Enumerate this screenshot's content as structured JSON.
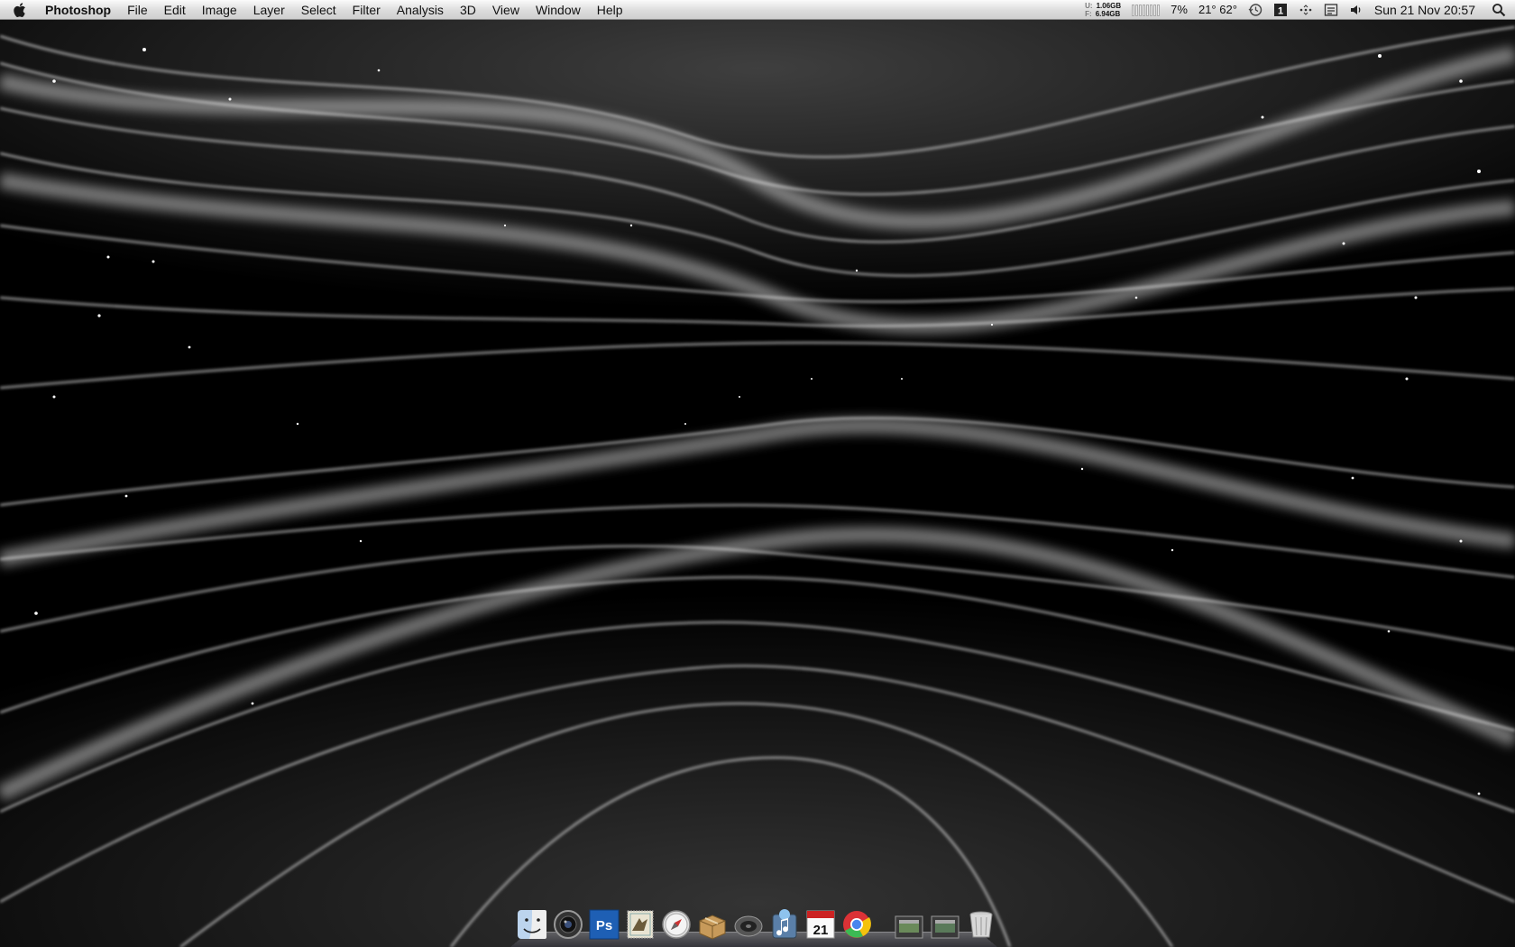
{
  "menubar": {
    "apple_icon": "apple-logo-icon",
    "app_name": "Photoshop",
    "menus": [
      "File",
      "Edit",
      "Image",
      "Layer",
      "Select",
      "Filter",
      "Analysis",
      "3D",
      "View",
      "Window",
      "Help"
    ],
    "status": {
      "memory_used_key": "U:",
      "memory_used": "1.06GB",
      "memory_free_key": "F:",
      "memory_free": "6.94GB",
      "cpu_percent": "7%",
      "temperature": "21° 62°",
      "datetime": "Sun 21 Nov  20:57"
    }
  },
  "dock": {
    "items": [
      {
        "name": "finder",
        "icon": "finder-icon"
      },
      {
        "name": "aperture",
        "icon": "aperture-lens-icon"
      },
      {
        "name": "photoshop",
        "icon": "photoshop-icon",
        "label": "Ps"
      },
      {
        "name": "mail",
        "icon": "mail-stamp-icon"
      },
      {
        "name": "safari",
        "icon": "safari-compass-icon"
      },
      {
        "name": "installer",
        "icon": "package-box-icon"
      },
      {
        "name": "speaker",
        "icon": "speaker-icon"
      },
      {
        "name": "itunes",
        "icon": "itunes-icon"
      },
      {
        "name": "ical",
        "icon": "calendar-icon",
        "label": "21"
      },
      {
        "name": "chrome",
        "icon": "chrome-icon"
      },
      {
        "name": "stack-1",
        "icon": "folder-stack-icon"
      },
      {
        "name": "stack-2",
        "icon": "folder-stack-icon"
      },
      {
        "name": "trash",
        "icon": "trash-icon"
      }
    ]
  },
  "colors": {
    "wallpaper_bg": "#000000",
    "wave": "#d8d8d8",
    "photoshop_blue": "#1e5fb4",
    "menubar_text": "#111111"
  }
}
